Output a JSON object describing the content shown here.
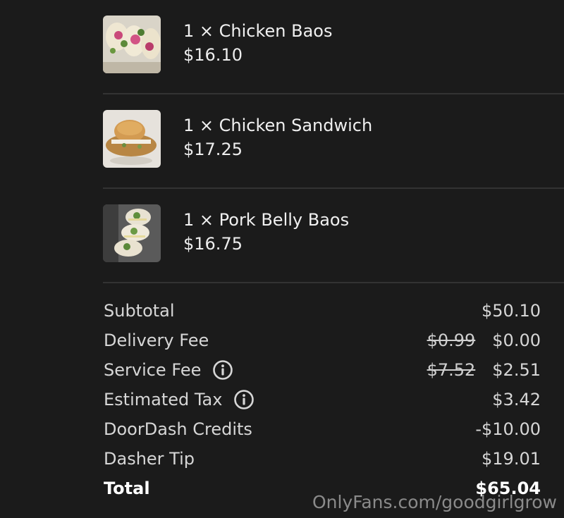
{
  "items": [
    {
      "name": "1 × Chicken Baos",
      "price": "$16.10",
      "image": "chicken-baos-photo"
    },
    {
      "name": "1 × Chicken Sandwich",
      "price": "$17.25",
      "image": "chicken-sandwich-photo"
    },
    {
      "name": "1 × Pork Belly Baos",
      "price": "$16.75",
      "image": "pork-belly-baos-photo"
    }
  ],
  "summary": {
    "subtotal": {
      "label": "Subtotal",
      "value": "$50.10"
    },
    "delivery_fee": {
      "label": "Delivery Fee",
      "original": "$0.99",
      "value": "$0.00"
    },
    "service_fee": {
      "label": "Service Fee",
      "original": "$7.52",
      "value": "$2.51",
      "icon": "info-icon"
    },
    "estimated_tax": {
      "label": "Estimated Tax",
      "value": "$3.42",
      "icon": "info-icon"
    },
    "credits": {
      "label": "DoorDash Credits",
      "value": "-$10.00"
    },
    "tip": {
      "label": "Dasher Tip",
      "value": "$19.01"
    },
    "total": {
      "label": "Total",
      "value": "$65.04"
    }
  },
  "watermark": "OnlyFans.com/goodgirlgrow",
  "colors": {
    "background": "#1b1b1b",
    "divider": "#333333",
    "text": "#ececec"
  }
}
